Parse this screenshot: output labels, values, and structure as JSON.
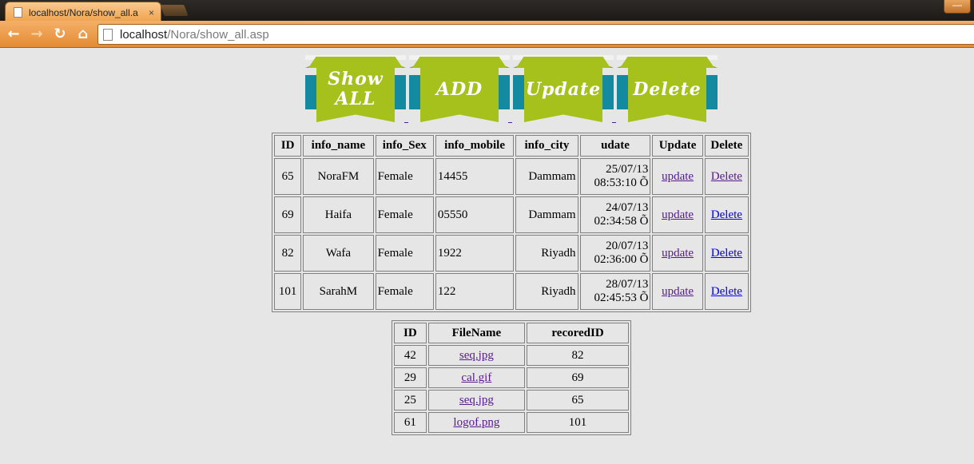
{
  "browser": {
    "tab_title": "localhost/Nora/show_all.a",
    "tab_close": "×",
    "url_host": "localhost",
    "url_path": "/Nora/show_all.asp",
    "window_button": "—"
  },
  "banners": [
    {
      "label": "Show\nALL"
    },
    {
      "label": "ADD"
    },
    {
      "label": "Update"
    },
    {
      "label": "Delete"
    }
  ],
  "info_table": {
    "headers": [
      "ID",
      "info_name",
      "info_Sex",
      "info_mobile",
      "info_city",
      "udate",
      "Update",
      "Delete"
    ],
    "rows": [
      {
        "id": "65",
        "name": "NoraFM",
        "sex": "Female",
        "mobile": "14455",
        "city": "Dammam",
        "date": "25/07/13",
        "time": "08:53:10 Õ",
        "update": "update",
        "delete": "Delete"
      },
      {
        "id": "69",
        "name": "Haifa",
        "sex": "Female",
        "mobile": "05550",
        "city": "Dammam",
        "date": "24/07/13",
        "time": "02:34:58 Õ",
        "update": "update",
        "delete": "Delete"
      },
      {
        "id": "82",
        "name": "Wafa",
        "sex": "Female",
        "mobile": "1922",
        "city": "Riyadh",
        "date": "20/07/13",
        "time": "02:36:00 Õ",
        "update": "update",
        "delete": "Delete"
      },
      {
        "id": "101",
        "name": "SarahM",
        "sex": "Female",
        "mobile": "122",
        "city": "Riyadh",
        "date": "28/07/13",
        "time": "02:45:53 Õ",
        "update": "update",
        "delete": "Delete"
      }
    ]
  },
  "files_table": {
    "headers": [
      "ID",
      "FileName",
      "recoredID"
    ],
    "rows": [
      {
        "id": "42",
        "file": "seq.jpg",
        "rec": "82"
      },
      {
        "id": "29",
        "file": "cal.gif",
        "rec": "69"
      },
      {
        "id": "25",
        "file": "seq.jpg",
        "rec": "65"
      },
      {
        "id": "61",
        "file": "logof.png",
        "rec": "101"
      }
    ]
  },
  "colors": {
    "page_bg": "#e6e6e6",
    "ribbon_green": "#a7c11c",
    "banner_teal": "#138aa0",
    "visited_link": "#551a8b",
    "link": "#0000ee"
  }
}
